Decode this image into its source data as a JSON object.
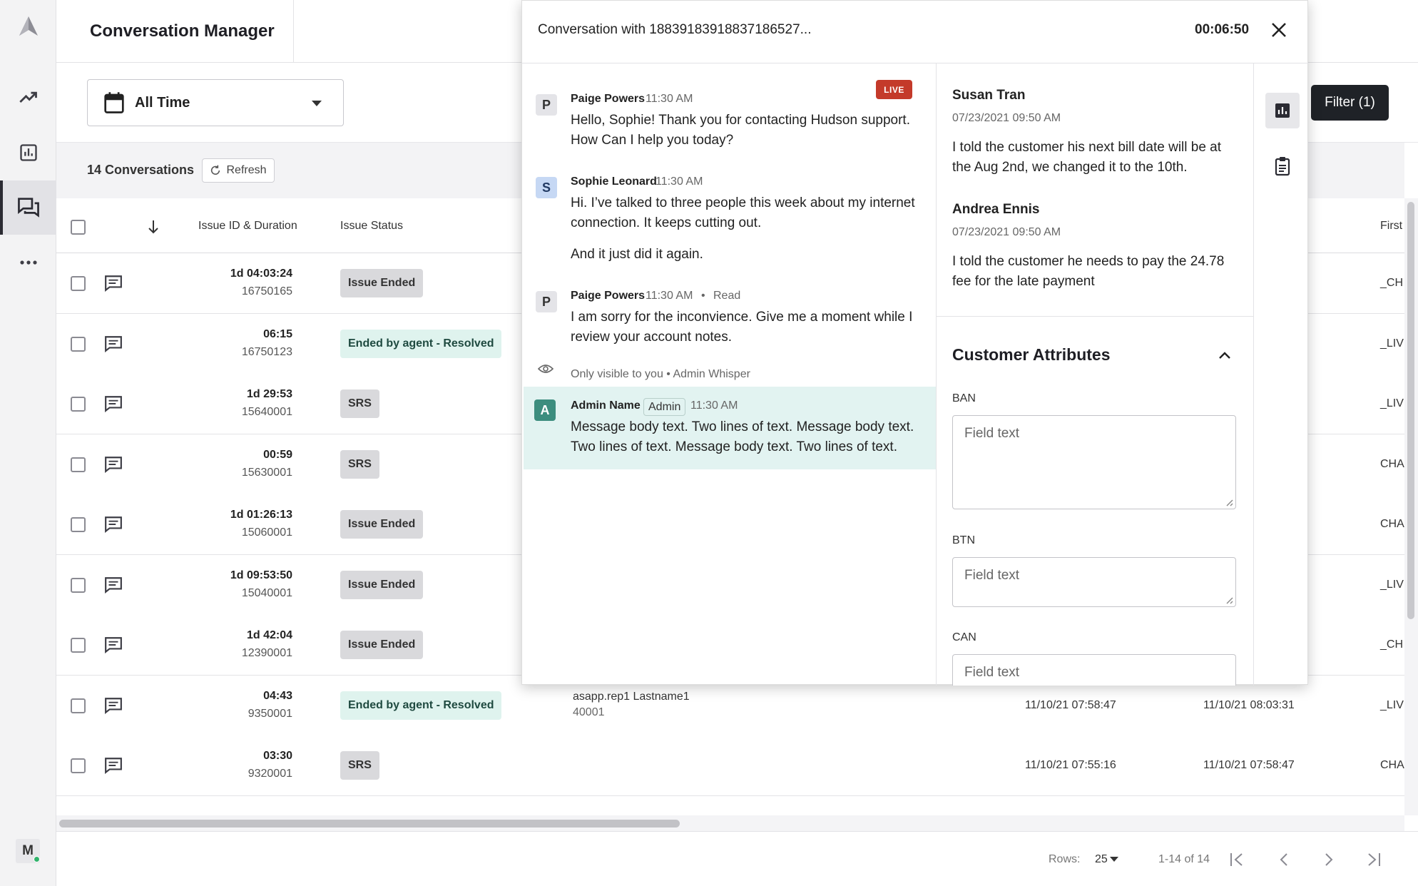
{
  "app": {
    "title": "Conversation Manager"
  },
  "filters": {
    "time_range": "All Time",
    "filter_button": "Filter (1)"
  },
  "list": {
    "count_label": "14 Conversations",
    "refresh_label": "Refresh"
  },
  "table": {
    "headers": {
      "issue_id_duration": "Issue ID & Duration",
      "issue_status": "Issue Status",
      "first": "First"
    },
    "rows": [
      {
        "duration": "1d 04:03:24",
        "issue_id": "16750165",
        "status": "Issue Ended",
        "edge": "_CH"
      },
      {
        "duration": "06:15",
        "issue_id": "16750123",
        "status": "Ended by agent - Resolved",
        "edge": "_LIV"
      },
      {
        "duration": "1d 29:53",
        "issue_id": "15640001",
        "status": "SRS",
        "edge": "_LIV"
      },
      {
        "duration": "00:59",
        "issue_id": "15630001",
        "status": "SRS",
        "edge": "CHA"
      },
      {
        "duration": "1d 01:26:13",
        "issue_id": "15060001",
        "status": "Issue Ended",
        "edge": "CHA"
      },
      {
        "duration": "1d 09:53:50",
        "issue_id": "15040001",
        "status": "Issue Ended",
        "edge": "_LIV"
      },
      {
        "duration": "1d 42:04",
        "issue_id": "12390001",
        "status": "Issue Ended",
        "edge": "_CH"
      },
      {
        "duration": "04:43",
        "issue_id": "9350001",
        "status": "Ended by agent - Resolved",
        "agent": "asapp.rep1 Lastname1",
        "agent_id": "40001",
        "start": "11/10/21 07:58:47",
        "end": "11/10/21 08:03:31",
        "edge": "_LIV"
      },
      {
        "duration": "03:30",
        "issue_id": "9320001",
        "status": "SRS",
        "start": "11/10/21 07:55:16",
        "end": "11/10/21 07:58:47",
        "edge": "CHA"
      }
    ]
  },
  "pagination": {
    "rows_label": "Rows:",
    "rows_value": "25",
    "range": "1-14 of 14"
  },
  "user": {
    "initial": "M"
  },
  "conversation": {
    "title": "Conversation with 18839183918837186527...",
    "timer": "00:06:50",
    "live_label": "LIVE",
    "messages": [
      {
        "sender": "Paige Powers",
        "initial": "P",
        "time": "11:30 AM",
        "text": "Hello, Sophie! Thank you for contacting Hudson support. How Can I help you today?"
      },
      {
        "sender": "Sophie Leonard",
        "initial": "S",
        "time": "11:30 AM",
        "text": "Hi. I’ve talked to three people this week about my internet connection. It keeps cutting out.",
        "text2": "And it just did it again."
      },
      {
        "sender": "Paige Powers",
        "initial": "P",
        "time": "11:30 AM",
        "read": "Read",
        "text": "I am sorry for the inconvience. Give me a moment while I review your account notes."
      },
      {
        "sender": "Admin Name",
        "initial": "A",
        "tag": "Admin",
        "time": "11:30 AM",
        "text": "Message body text. Two lines of text. Message body text. Two lines of text. Message body text. Two lines of text."
      }
    ],
    "whisper_note": "Only visible to you • Admin Whisper"
  },
  "notes": [
    {
      "author": "Susan Tran",
      "date": "07/23/2021 09:50 AM",
      "text": "I told the customer his next bill date will be at the Aug 2nd, we changed it to the 10th."
    },
    {
      "author": "Andrea Ennis",
      "date": "07/23/2021 09:50 AM",
      "text": "I told the customer he needs to pay the 24.78 fee for the late payment"
    }
  ],
  "customer_attributes": {
    "title": "Customer Attributes",
    "fields": [
      {
        "label": "BAN",
        "placeholder": "Field text"
      },
      {
        "label": "BTN",
        "placeholder": "Field text"
      },
      {
        "label": "CAN",
        "placeholder": "Field text"
      }
    ]
  }
}
